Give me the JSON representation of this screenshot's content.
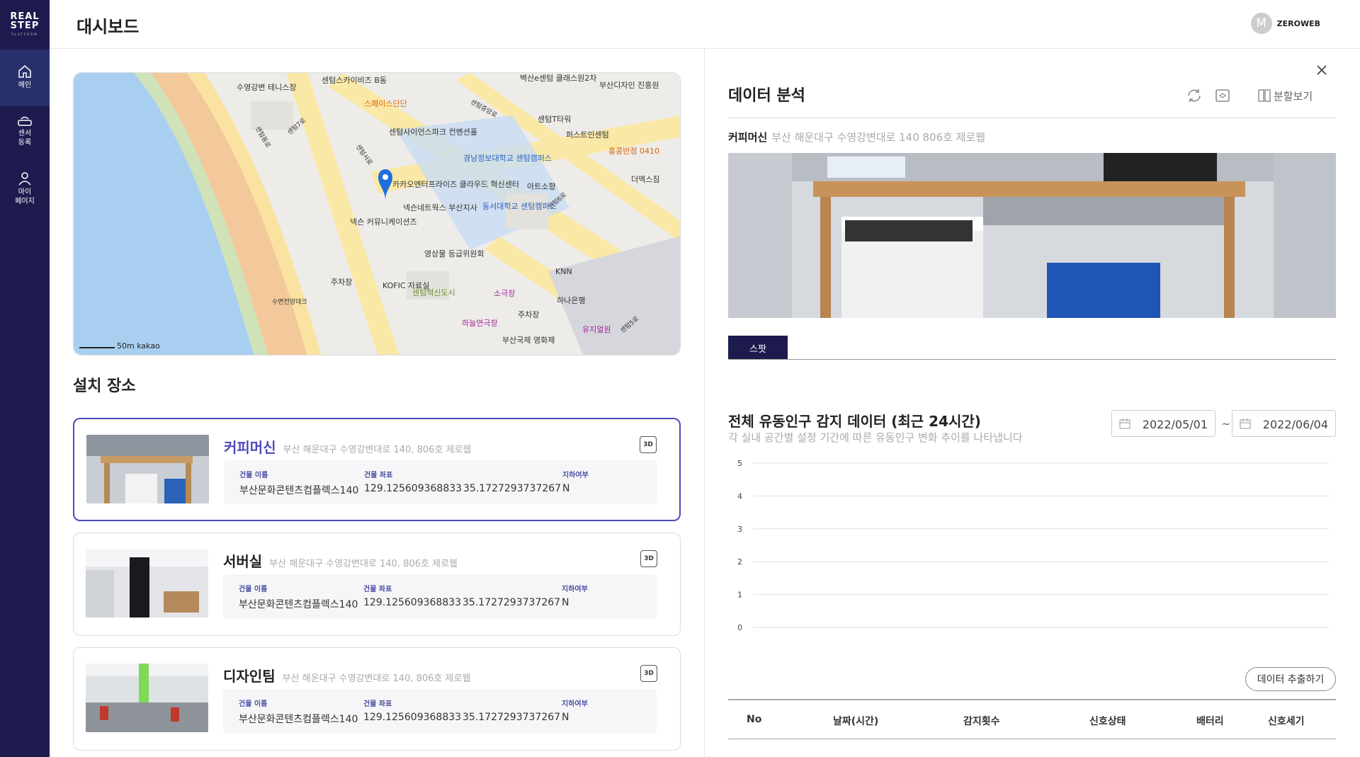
{
  "app": {
    "logo_line1": "REAL",
    "logo_line2": "STEP",
    "logo_sub": "PLATFORM"
  },
  "sidebar": {
    "items": [
      {
        "label": "메인",
        "icon": "home-icon",
        "active": true
      },
      {
        "label": "센서\n등록",
        "icon": "sensor-icon",
        "active": false
      },
      {
        "label": "마이\n페이지",
        "icon": "user-icon",
        "active": false
      }
    ]
  },
  "header": {
    "title": "대시보드",
    "user_initial": "M",
    "user_name": "ZEROWEB"
  },
  "map": {
    "scale": "50m",
    "brand": "kakao",
    "labels": [
      "센텀스카이비즈 B동",
      "수영강변 테니스장",
      "스페이스단단",
      "센텀사이언스파크 컨벤션홀",
      "벽산e센텀 클래스원2차",
      "부산디자인 진흥원",
      "센텀T타워",
      "퍼스트인센텀",
      "경남정보대학교 센텀캠퍼스",
      "홍콩반점 0410",
      "아트소향",
      "더엑스짐",
      "카카오엔터프라이즈 클라우드 혁신센터",
      "넥슨네트웍스 부산지사",
      "동서대학교 센텀캠퍼스",
      "넥슨 커뮤니케이션즈",
      "영상물 등급위원회",
      "KNN",
      "주차장",
      "KOFIC 자료실",
      "센텀혁신도시",
      "소극장",
      "하나은행",
      "하늘연극장",
      "주차장",
      "유지얼원",
      "부산국제 영화제",
      "수변전망데크",
      "센텀7로",
      "센텀동로",
      "센텀서로",
      "센텀6로",
      "센텀5로",
      "센텀중앙로"
    ]
  },
  "installs": {
    "title": "설치 장소",
    "headers": {
      "building": "건물 이름",
      "coords": "건물 좌표",
      "basement": "지하여부"
    },
    "cards": [
      {
        "name": "커피머신",
        "addr": "부산 해운대구 수영강변대로 140, 806호 제로웹",
        "building": "부산문화콘텐츠컴플렉스140",
        "lng": "129.125609368833",
        "lat": "35.1727293737267",
        "basement": "N",
        "selected": true
      },
      {
        "name": "서버실",
        "addr": "부산 해운대구 수영강변대로 140, 806호 제로웹",
        "building": "부산문화콘텐츠컴플렉스140",
        "lng": "129.125609368833",
        "lat": "35.1727293737267",
        "basement": "N",
        "selected": false
      },
      {
        "name": "디자인팀",
        "addr": "부산 해운대구 수영강변대로 140, 806호 제로웹",
        "building": "부산문화콘텐츠컴플렉스140",
        "lng": "129.125609368833",
        "lat": "35.1727293737267",
        "basement": "N",
        "selected": false
      }
    ],
    "icon_3d": "3D"
  },
  "panel": {
    "title": "데이터 분석",
    "split_view": "분할보기",
    "loc_name": "커피머신",
    "loc_addr": "부산 해운대구 수영강변대로 140 806호 제로웹",
    "tab": "스팟",
    "chart_title": "전체 유동인구 감지 데이터 (최근 24시간)",
    "chart_sub": "각 실내 공간별 설정 기간에 따른 유동인구 변화 추이를 나타냅니다",
    "date_from": "2022/05/01",
    "date_sep": "~",
    "date_to": "2022/06/04",
    "export": "데이터 추출하기",
    "table_headers": [
      "No",
      "날짜(시간)",
      "감지횟수",
      "신호상태",
      "배터리",
      "신호세기"
    ]
  },
  "chart_data": {
    "type": "line",
    "title": "전체 유동인구 감지 데이터 (최근 24시간)",
    "x": [],
    "series": [],
    "ylim": [
      0,
      5
    ],
    "yticks": [
      "0",
      "1",
      "2",
      "3",
      "4",
      "5"
    ],
    "grid": true
  },
  "colors": {
    "sidebar": "#1d1b4e",
    "accent": "#4c4ab8",
    "label": "#4a4fa3"
  }
}
